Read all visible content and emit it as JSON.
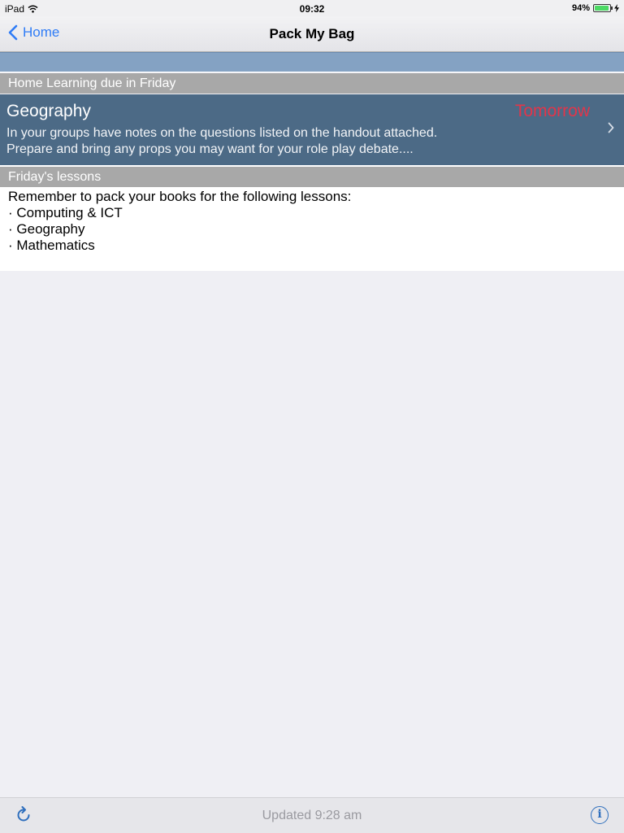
{
  "status_bar": {
    "device": "iPad",
    "time": "09:32",
    "battery": "94%",
    "battery_level": 0.94
  },
  "nav": {
    "back_label": "Home",
    "title": "Pack My Bag"
  },
  "homework_section": {
    "header": "Home Learning due in Friday",
    "items": [
      {
        "subject": "Geography",
        "due": "Tomorrow",
        "description_line1": "In your groups have notes on the questions listed on the handout attached.",
        "description_line2": "Prepare and bring any props you may want for your role play debate...."
      }
    ]
  },
  "lessons_section": {
    "header": "Friday's lessons",
    "intro": "Remember to pack your books for the following lessons:",
    "lessons": [
      "Computing & ICT",
      "Geography",
      "Mathematics"
    ]
  },
  "toolbar": {
    "updated": "Updated 9:28 am",
    "info_glyph": "i"
  },
  "colors": {
    "accent": "#2f7cf6",
    "due_red": "#e2354a",
    "row_blue": "#4c6a86"
  }
}
